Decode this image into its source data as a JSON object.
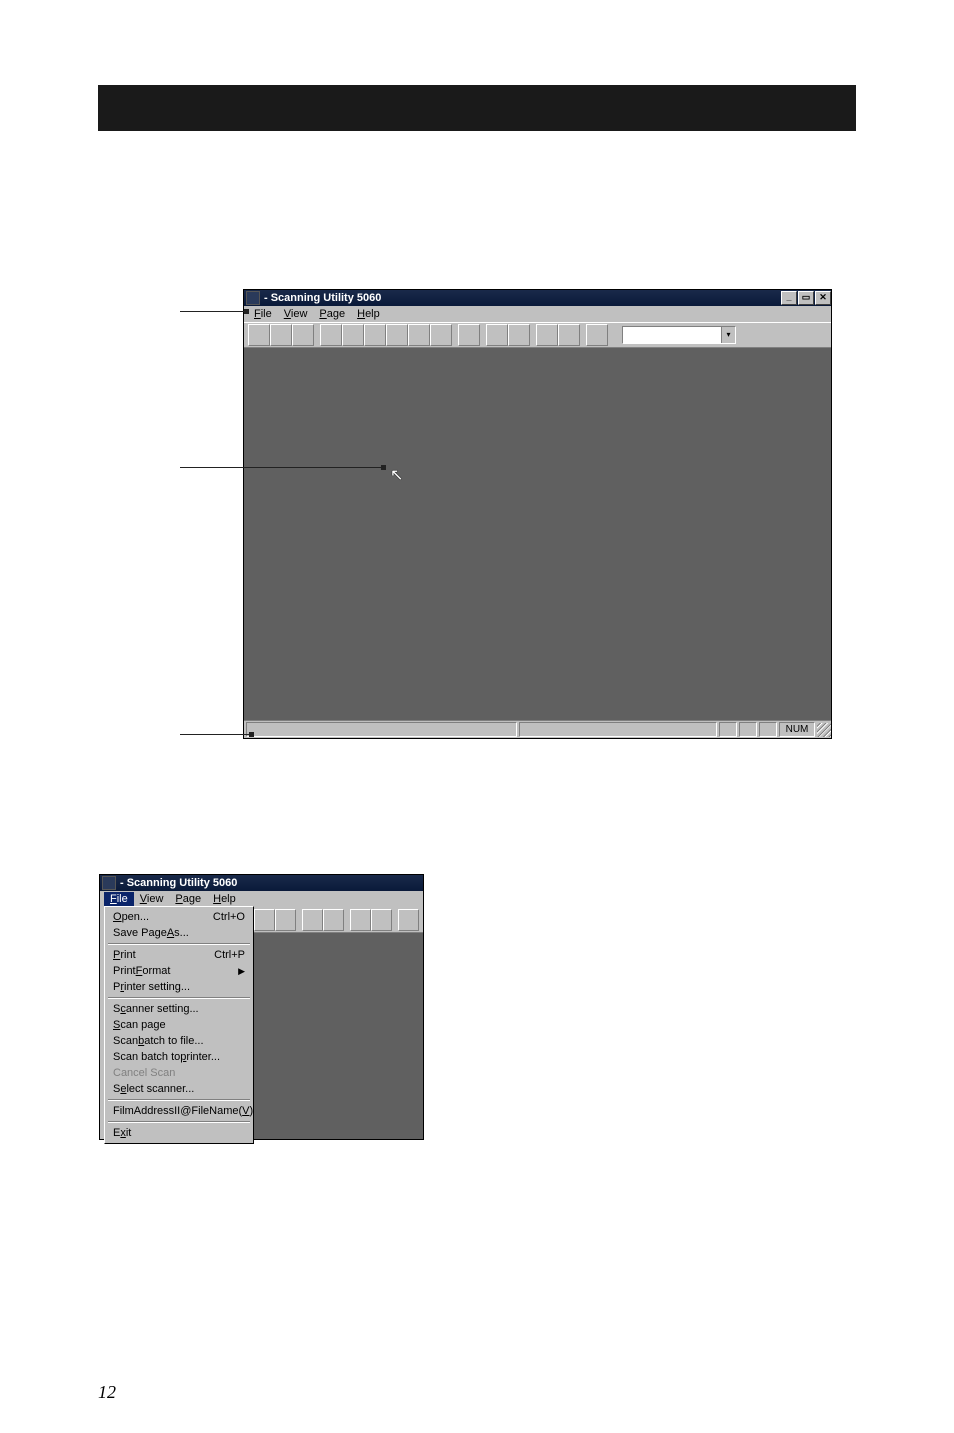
{
  "page_number": "12",
  "main_window": {
    "title": " - Scanning Utility 5060",
    "menus": [
      {
        "label": "File",
        "underline": 0
      },
      {
        "label": "View",
        "underline": 0
      },
      {
        "label": "Page",
        "underline": 0
      },
      {
        "label": "Help",
        "underline": 0
      }
    ],
    "sysbuttons": {
      "min": "_",
      "max": "▭",
      "close": "✕"
    },
    "status": {
      "num": "NUM"
    }
  },
  "file_menu_window": {
    "title": " - Scanning Utility 5060",
    "menus_with_file_selected": [
      {
        "label": "File",
        "underline": 0,
        "selected": true
      },
      {
        "label": "View",
        "underline": 0
      },
      {
        "label": "Page",
        "underline": 0
      },
      {
        "label": "Help",
        "underline": 0
      }
    ],
    "dropdown": [
      {
        "label": "Open...",
        "underline": 0,
        "shortcut": "Ctrl+O"
      },
      {
        "label": "Save Page As...",
        "underline": 10
      },
      {
        "sep": true
      },
      {
        "label": "Print",
        "underline": 0,
        "shortcut": "Ctrl+P"
      },
      {
        "label": "Print Format",
        "underline": 6,
        "submenu": true
      },
      {
        "label": "Printer setting...",
        "underline": 1
      },
      {
        "sep": true
      },
      {
        "label": "Scanner setting...",
        "underline": 1
      },
      {
        "label": "Scan page",
        "underline": 0
      },
      {
        "label": "Scan batch to file...",
        "underline": 5
      },
      {
        "label": "Scan batch to printer...",
        "underline": 14
      },
      {
        "label": "Cancel Scan",
        "disabled": true
      },
      {
        "label": "Select scanner...",
        "underline": 1
      },
      {
        "sep": true
      },
      {
        "label": "FilmAddressII@FileName(V)",
        "underline": 23
      },
      {
        "sep": true
      },
      {
        "label": "Exit",
        "underline": 1
      }
    ]
  },
  "toolbar_icons": [
    "open-icon",
    "save-icon",
    "scan-icon",
    "fit-width-icon",
    "fit-window-icon",
    "zoom-in-icon",
    "zoom-out-icon",
    "zoom-tool-icon",
    "actual-size-icon",
    "rotate-icon",
    "print-icon",
    "printer-setup-icon",
    "prev-page-icon",
    "next-page-icon",
    "about-icon"
  ],
  "toolbar_groups": [
    3,
    6,
    1,
    2,
    2,
    1
  ]
}
